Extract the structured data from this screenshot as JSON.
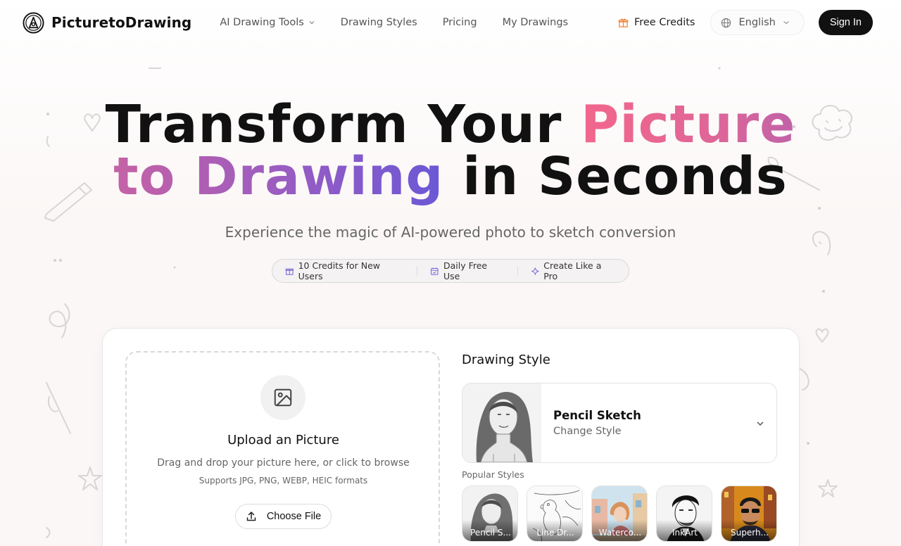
{
  "header": {
    "brand": "PicturetoDrawing",
    "nav": [
      {
        "label": "AI Drawing Tools",
        "has_dropdown": true
      },
      {
        "label": "Drawing Styles"
      },
      {
        "label": "Pricing"
      },
      {
        "label": "My Drawings"
      }
    ],
    "free_credits_label": "Free Credits",
    "language": "English",
    "sign_in_label": "Sign In"
  },
  "hero": {
    "title_part1": "Transform Your ",
    "title_highlight1": "Picture",
    "title_highlight2": "to Drawing",
    "title_part2": " in Seconds",
    "subtitle": "Experience the magic of AI-powered photo to sketch conversion",
    "badges": [
      {
        "icon": "gift-icon",
        "label": "10 Credits for New Users"
      },
      {
        "icon": "calendar-icon",
        "label": "Daily Free Use"
      },
      {
        "icon": "sparkle-icon",
        "label": "Create Like a Pro"
      }
    ]
  },
  "upload": {
    "title": "Upload an Picture",
    "description": "Drag and drop your picture here, or click to browse",
    "formats": "Supports JPG, PNG, WEBP, HEIC formats",
    "button_label": "Choose File"
  },
  "style_panel": {
    "heading": "Drawing Style",
    "selected_style": "Pencil Sketch",
    "change_label": "Change Style",
    "popular_label": "Popular Styles",
    "popular_styles": [
      {
        "label": "Pencil S..."
      },
      {
        "label": "Line Dr..."
      },
      {
        "label": "Waterco..."
      },
      {
        "label": "InkArt"
      },
      {
        "label": "Superh..."
      }
    ]
  },
  "colors": {
    "accent_pink": "#f2668c",
    "accent_purple": "#6a58d6",
    "free_credits_icon": "#f0883e",
    "badge_icon": "#7b6fd8"
  }
}
